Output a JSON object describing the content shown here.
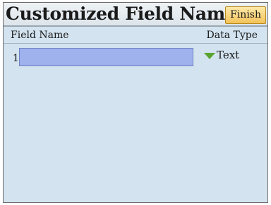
{
  "screen": {
    "title": "Customized Field Name",
    "finish_label": "Finish"
  },
  "columns": {
    "field_name": "Field Name",
    "data_type": "Data Type"
  },
  "rows": [
    {
      "index": "1",
      "field_name_value": "",
      "data_type": "Text",
      "dropdown_icon": "triangle-down-icon",
      "dropdown_icon_color": "#5aa52f"
    }
  ],
  "colors": {
    "background": "#d3e3ef",
    "input_highlight": "#9fb2ee",
    "finish_button": "#f2c25a"
  }
}
